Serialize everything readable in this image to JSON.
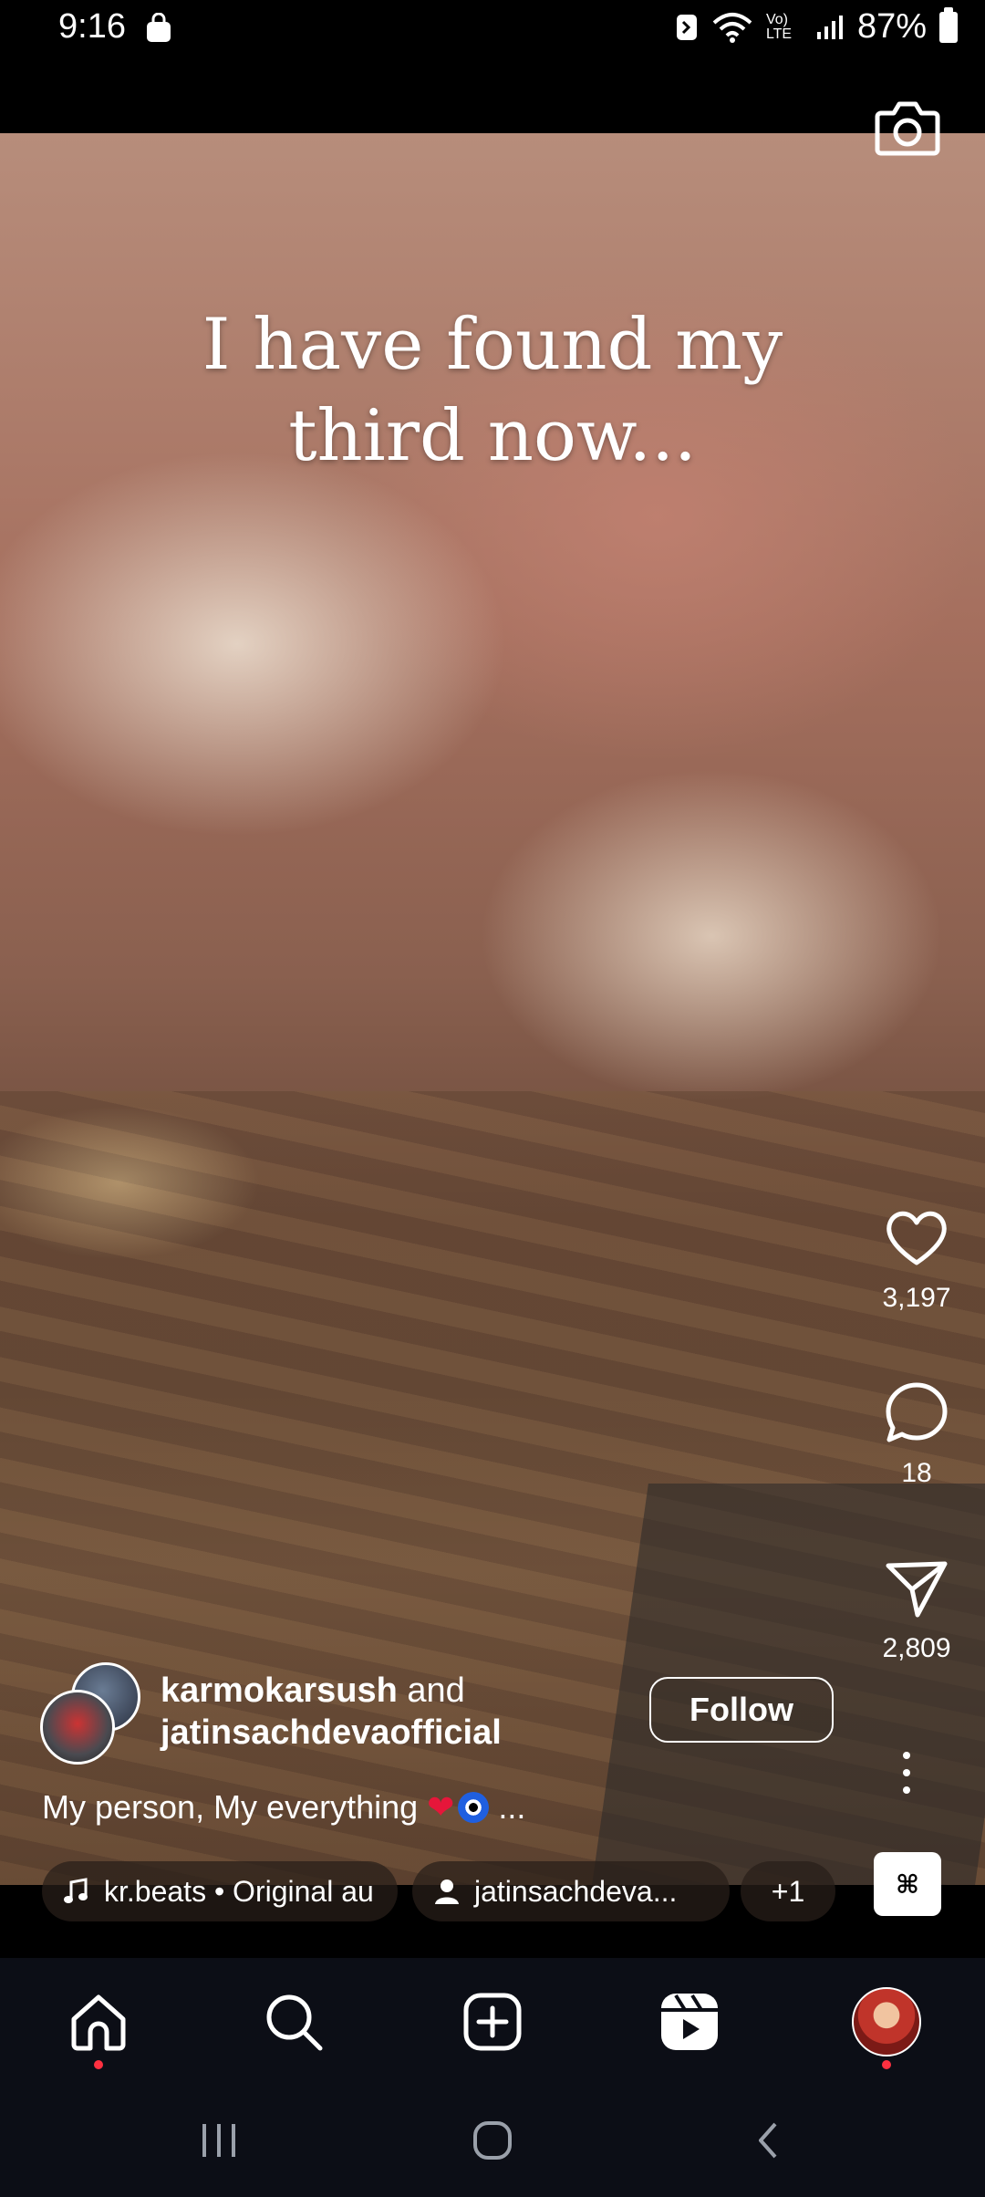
{
  "status_bar": {
    "time": "9:16",
    "network": "Vo) LTE",
    "battery": "87%"
  },
  "reel": {
    "overlay_text": [
      "I have found my",
      "third now..."
    ],
    "likes": "3,197",
    "comments": "18",
    "shares": "2,809"
  },
  "author": {
    "primary": "karmokarsush",
    "connector": "and",
    "collaborator": "jatinsachdevaofficial",
    "follow_label": "Follow"
  },
  "caption": {
    "text": "My person, My everything",
    "more": "..."
  },
  "chips": {
    "audio": "kr.beats • Original au",
    "tagged_user": "jatinsachdeva...",
    "extra": "+1"
  },
  "music_thumb": {
    "label": "⌘"
  },
  "colors": {
    "background": "#000000",
    "nav_bg": "#0c0e16",
    "notification_dot": "#ff3040",
    "heart_emoji": "#e6163a"
  },
  "icons": {
    "camera": "camera-icon",
    "like": "heart-outline-icon",
    "comment": "comment-icon",
    "share": "paper-plane-icon",
    "more": "more-vertical-icon",
    "home": "home-icon",
    "search": "search-icon",
    "create": "plus-square-icon",
    "reels": "reels-icon"
  }
}
